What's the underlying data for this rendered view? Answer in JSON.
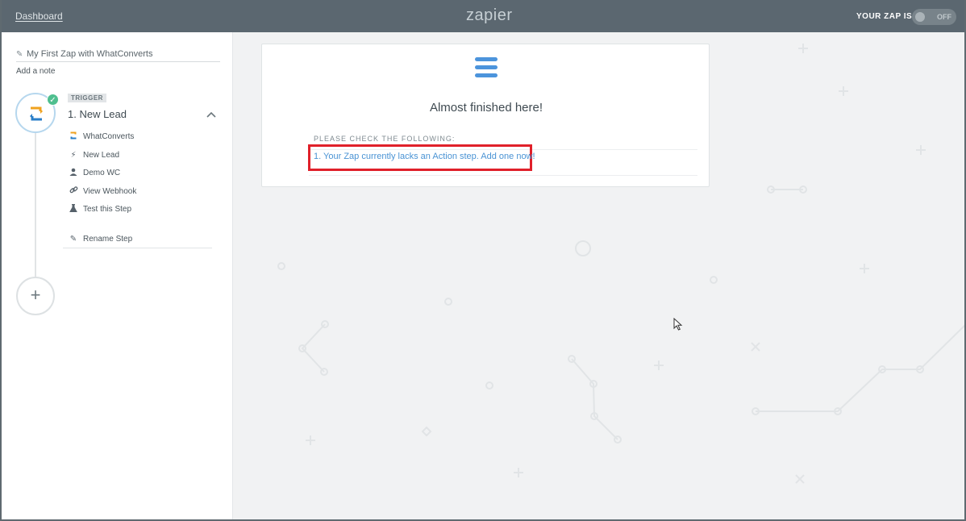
{
  "header": {
    "dashboard_link": "Dashboard",
    "logo": "zapier",
    "status_label": "YOUR ZAP IS",
    "toggle_state": "OFF"
  },
  "sidebar": {
    "zap_name": "My First Zap with WhatConverts",
    "add_note": "Add a note",
    "step": {
      "badge": "TRIGGER",
      "title": "1. New Lead",
      "app_icon": "whatconverts-icon",
      "completed": true,
      "items": [
        {
          "label": "WhatConverts",
          "icon": "whatconverts-icon"
        },
        {
          "label": "New Lead",
          "icon": "lightning-icon"
        },
        {
          "label": "Demo WC",
          "icon": "user-icon"
        },
        {
          "label": "View Webhook",
          "icon": "link-icon"
        },
        {
          "label": "Test this Step",
          "icon": "flask-icon"
        },
        {
          "label": "Rename Step",
          "icon": "pencil-icon"
        }
      ]
    },
    "add_step_symbol": "+"
  },
  "main": {
    "card": {
      "heading": "Almost finished here!",
      "check_label": "PLEASE CHECK THE FOLLOWING:",
      "issue_text": "1. Your Zap currently lacks an Action step. Add one now!"
    }
  },
  "colors": {
    "header_bg": "#5b6770",
    "accent_blue": "#4c94dc",
    "success_green": "#4fbf8f",
    "highlight_red": "#e0202a"
  }
}
